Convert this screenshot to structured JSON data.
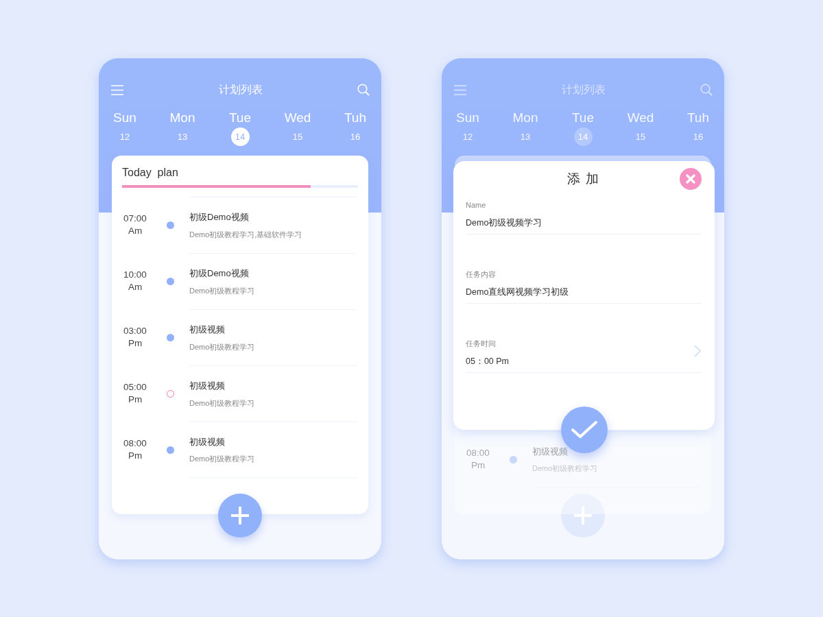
{
  "list_screen": {
    "title": "计划列表",
    "days": [
      {
        "day": "Sun",
        "date": "12",
        "selected": false
      },
      {
        "day": "Mon",
        "date": "13",
        "selected": false
      },
      {
        "day": "Tue",
        "date": "14",
        "selected": true
      },
      {
        "day": "Wed",
        "date": "15",
        "selected": false
      },
      {
        "day": "Tuh",
        "date": "16",
        "selected": false
      }
    ],
    "plan": {
      "title": "Today  plan",
      "level": 0.8
    },
    "tasks": [
      {
        "time": "07:00",
        "period": "Am",
        "title": "初级Demo视频",
        "subtitle": "Demo初级教程学习,基础软件学习",
        "highlighted": false
      },
      {
        "time": "10:00",
        "period": "Am",
        "title": "初级Demo视频",
        "subtitle": "Demo初级教程学习",
        "highlighted": false
      },
      {
        "time": "03:00",
        "period": "Pm",
        "title": "初级视频",
        "subtitle": "Demo初级教程学习",
        "highlighted": false
      },
      {
        "time": "05:00",
        "period": "Pm",
        "title": "初级视频",
        "subtitle": "Demo初级教程学习",
        "highlighted": true
      },
      {
        "time": "08:00",
        "period": "Pm",
        "title": "初级视频",
        "subtitle": "Demo初级教程学习",
        "highlighted": false
      }
    ]
  },
  "add_screen": {
    "title": "计划列表",
    "days": [
      {
        "day": "Sun",
        "date": "12",
        "selected": false
      },
      {
        "day": "Mon",
        "date": "13",
        "selected": false
      },
      {
        "day": "Tue",
        "date": "14",
        "selected": true
      },
      {
        "day": "Wed",
        "date": "15",
        "selected": false
      },
      {
        "day": "Tuh",
        "date": "16",
        "selected": false
      }
    ],
    "tasks": [
      {
        "time": "08:00",
        "period": "Pm",
        "title": "初级视频",
        "subtitle": "Demo初级教程学习",
        "highlighted": false
      }
    ],
    "dialog": {
      "title": "添 加",
      "fields": [
        {
          "kind": "text",
          "label": "Name",
          "value": "Demo初级视频学习"
        },
        {
          "kind": "text",
          "label": "任务内容",
          "value": "Demo直线网视频学习初级"
        },
        {
          "kind": "picker",
          "label": "任务时间",
          "value": "05：00 Pm"
        }
      ]
    }
  }
}
